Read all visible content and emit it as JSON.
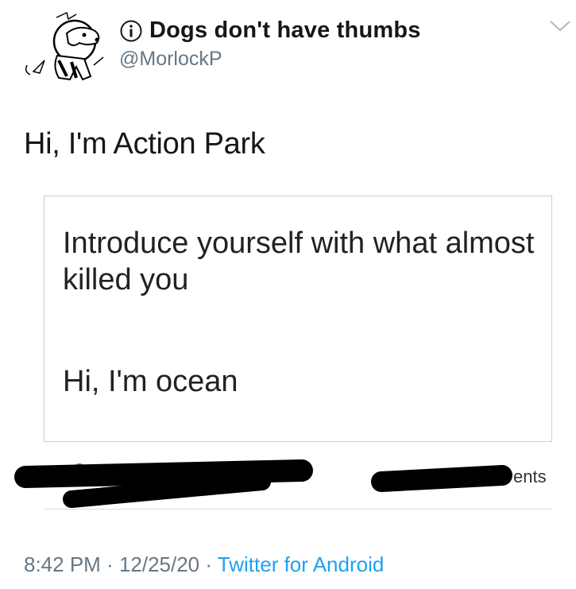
{
  "author": {
    "display_name": "Dogs don't have thumbs",
    "handle": "@MorlockP"
  },
  "tweet": {
    "text": "Hi, I'm Action Park"
  },
  "embedded_card": {
    "prompt": "Introduce yourself with what almost killed you",
    "reply": "Hi, I'm ocean",
    "partial_text": "ents"
  },
  "meta": {
    "time": "8:42 PM",
    "separator": " · ",
    "date": "12/25/20",
    "source": "Twitter for Android"
  },
  "colors": {
    "text": "#14171a",
    "secondary": "#657786",
    "link": "#1da1f2"
  },
  "icons": [
    "info-icon",
    "chevron-down-icon"
  ]
}
